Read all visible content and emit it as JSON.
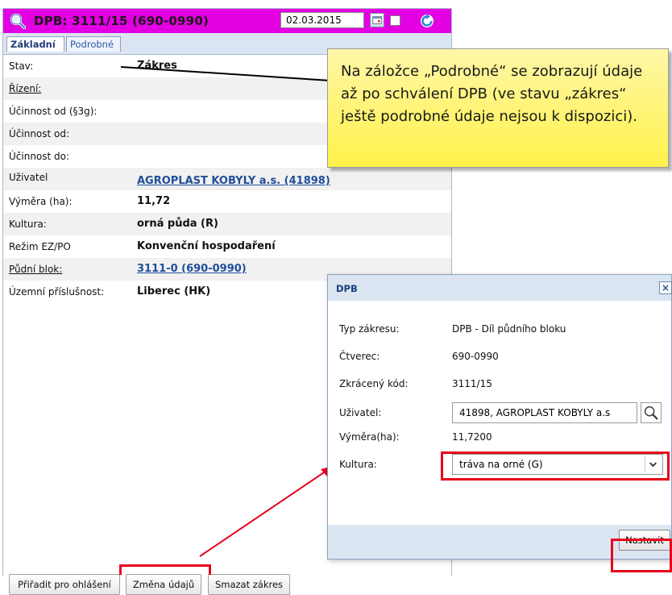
{
  "header": {
    "title": "DPB: 3111/15 (690-0990)",
    "date": "02.03.2015"
  },
  "tabs": [
    {
      "label": "Základní"
    },
    {
      "label": "Podrobné"
    }
  ],
  "fields": [
    {
      "label": "Stav:",
      "value": "Zákres"
    },
    {
      "label": "Řízení:",
      "value": ""
    },
    {
      "label": "Účinnost od (§3g):",
      "value": ""
    },
    {
      "label": "Účinnost od:",
      "value": ""
    },
    {
      "label": "Účinnost do:",
      "value": ""
    },
    {
      "label": "Uživatel",
      "value": "AGROPLAST KOBYLY a.s. (41898)"
    },
    {
      "label": "Výměra (ha):",
      "value": "11,72"
    },
    {
      "label": "Kultura:",
      "value": "orná půda (R)"
    },
    {
      "label": "Režim EZ/PO",
      "value": "Konvenční hospodaření"
    },
    {
      "label": "Půdní blok:",
      "value": "3111-0 (690-0990)"
    },
    {
      "label": "Územní příslušnost:",
      "value": "Liberec (HK)"
    }
  ],
  "buttons": {
    "assign": "Přiřadit pro ohlášení",
    "change": "Změna údajů",
    "delete": "Smazat zákres"
  },
  "callout": {
    "text": "Na záložce „Podrobné“ se zobrazují údaje až po schválení DPB (ve stavu „zákres“ ještě podrobné údaje nejsou k dispozici)."
  },
  "dialog": {
    "title": "DPB",
    "close": "×",
    "rows": [
      {
        "label": "Typ zákresu:",
        "value": "DPB - Díl půdního bloku"
      },
      {
        "label": "Čtverec:",
        "value": "690-0990"
      },
      {
        "label": "Zkrácený kód:",
        "value": "3111/15"
      },
      {
        "label": "Uživatel:",
        "value": "41898, AGROPLAST KOBYLY a.s"
      },
      {
        "label": "Výměra(ha):",
        "value": "11,7200"
      },
      {
        "label": "Kultura:",
        "value": "tráva na orné (G)"
      }
    ],
    "submit": "Nastavit"
  },
  "colors": {
    "header_bg": "#e300e3",
    "highlight": "#e8001c",
    "link": "#1f4e9b",
    "callout_bg": "#fff24a"
  },
  "icons": [
    "search-icon",
    "calendar-icon",
    "refresh-icon",
    "close-icon",
    "chevron-down-icon"
  ]
}
